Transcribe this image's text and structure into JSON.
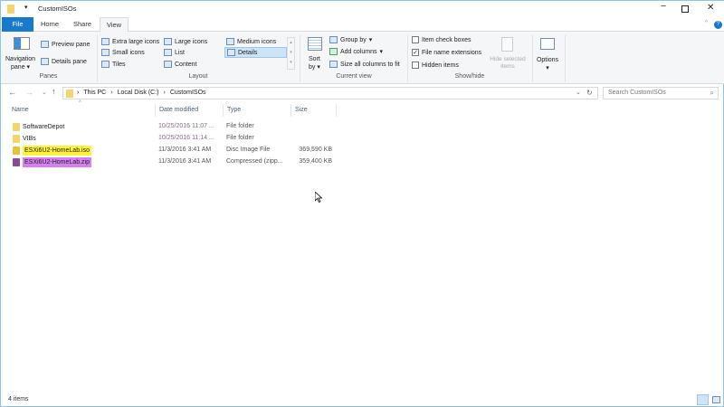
{
  "window": {
    "title": "CustomISOs"
  },
  "tabs": [
    {
      "label": "File"
    },
    {
      "label": "Home"
    },
    {
      "label": "Share"
    },
    {
      "label": "View",
      "active": true
    }
  ],
  "ribbon": {
    "panes": {
      "label": "Panes",
      "navigation_pane": "Navigation",
      "navigation_pane2": "pane",
      "preview_pane": "Preview pane",
      "details_pane": "Details pane"
    },
    "layout": {
      "label": "Layout",
      "items": [
        "Extra large icons",
        "Large icons",
        "Medium icons",
        "Small icons",
        "List",
        "Details",
        "Tiles",
        "Content"
      ],
      "selected": "Details"
    },
    "current_view": {
      "label": "Current view",
      "sort_by": "Sort",
      "sort_by2": "by",
      "group_by": "Group by",
      "add_columns": "Add columns",
      "size_all": "Size all columns to fit"
    },
    "show_hide": {
      "label": "Show/hide",
      "item_check_boxes": "Item check boxes",
      "file_name_extensions": "File name extensions",
      "hidden_items": "Hidden items",
      "item_check_boxes_checked": false,
      "file_name_extensions_checked": true,
      "hidden_items_checked": false,
      "hide_selected": "Hide selected",
      "hide_selected2": "items"
    },
    "options": {
      "label": "Options"
    }
  },
  "address": {
    "crumbs": [
      "This PC",
      "Local Disk (C:)",
      "CustomISOs"
    ]
  },
  "search": {
    "placeholder": "Search CustomISOs"
  },
  "columns": [
    "Name",
    "Date modified",
    "Type",
    "Size"
  ],
  "files": [
    {
      "name": "SoftwareDepot",
      "date": "10/25/2016 11:07 ...",
      "type": "File folder",
      "size": "",
      "highlight": "",
      "icon": "folder-icon"
    },
    {
      "name": "VIBs",
      "date": "10/25/2016 11:14 ...",
      "type": "File folder",
      "size": "",
      "highlight": "",
      "icon": "folder-icon"
    },
    {
      "name": "ESXi6U2-HomeLab.iso",
      "date": "11/3/2016 3:41 AM",
      "type": "Disc Image File",
      "size": "369,590 KB",
      "highlight": "#fff23a",
      "icon": "disc-image-icon"
    },
    {
      "name": "ESXi6U2-HomeLab.zip",
      "date": "11/3/2016 3:41 AM",
      "type": "Compressed (zipp...",
      "size": "359,400 KB",
      "highlight": "#d57ff0",
      "icon": "zip-icon"
    }
  ],
  "status": {
    "item_count": "4 items"
  },
  "colors": {
    "accent": "#1979ca",
    "folder": "#f3d46e"
  }
}
